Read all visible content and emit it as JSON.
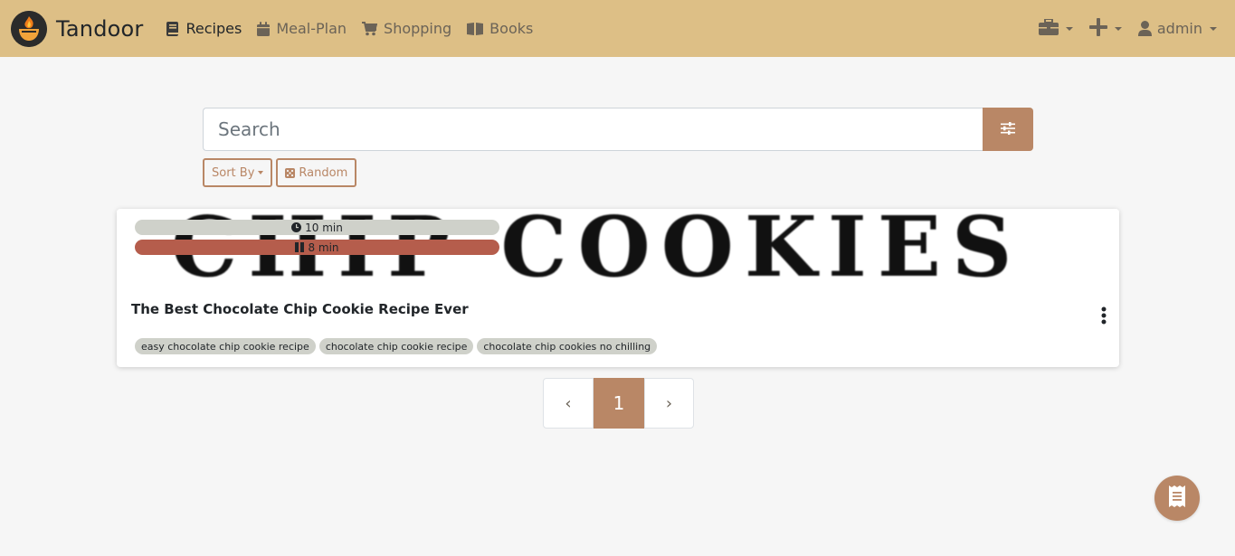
{
  "navbar": {
    "brand": "Tandoor",
    "links": [
      {
        "label": "Recipes",
        "icon": "book-icon",
        "active": true
      },
      {
        "label": "Meal-Plan",
        "icon": "calendar-icon",
        "active": false
      },
      {
        "label": "Shopping",
        "icon": "cart-icon",
        "active": false
      },
      {
        "label": "Books",
        "icon": "open-book-icon",
        "active": false
      }
    ],
    "user": "admin",
    "background": "#ddbf86"
  },
  "search": {
    "placeholder": "Search"
  },
  "controls": {
    "sort_label": "Sort By",
    "random_label": "Random"
  },
  "recipe": {
    "title": "The Best Chocolate Chip Cookie Recipe Ever",
    "image_text": "CHIP COOKIES",
    "working_time": "10 min",
    "waiting_time": "8 min",
    "keywords": [
      "easy chocolate chip cookie recipe",
      "chocolate chip cookie recipe",
      "chocolate chip cookies no chilling"
    ]
  },
  "pagination": {
    "prev": "‹",
    "current": "1",
    "next": "›"
  },
  "colors": {
    "accent": "#b98766",
    "waiting_badge": "#b55d4c",
    "keyword_badge": "#cfd1ca"
  }
}
